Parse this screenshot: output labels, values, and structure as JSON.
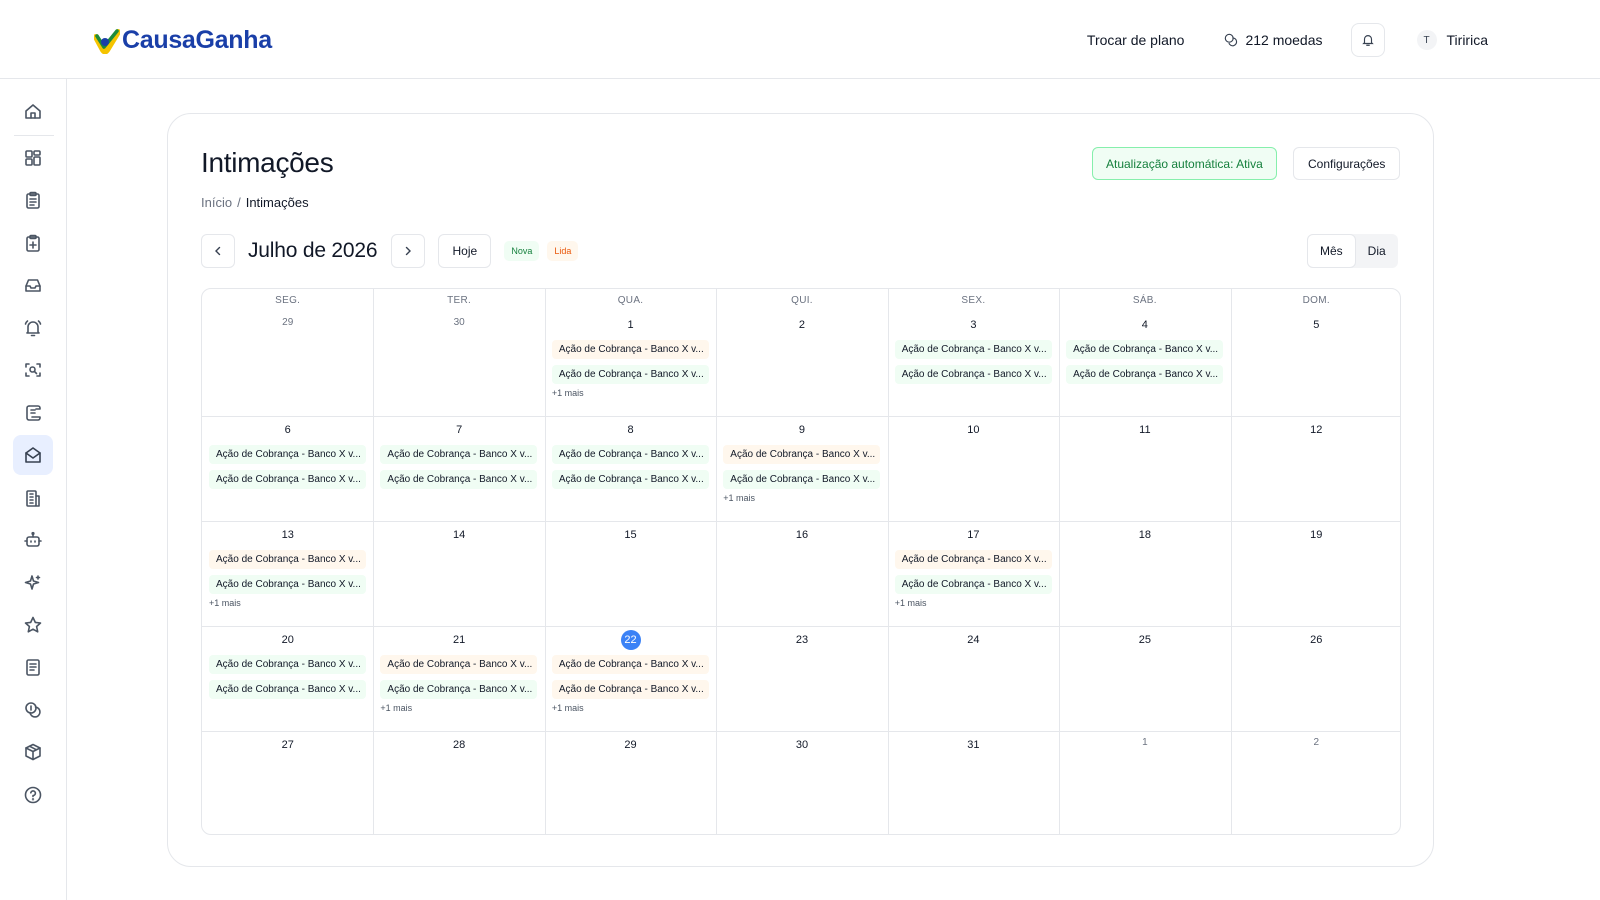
{
  "app": {
    "name": "CausaGanha"
  },
  "header": {
    "change_plan": "Trocar de plano",
    "coins": "212 moedas",
    "user_initial": "T",
    "user_name": "Tiririca"
  },
  "sidebar": {
    "items": [
      {
        "icon": "home-icon"
      },
      {
        "icon": "dashboard-icon"
      },
      {
        "icon": "clipboard-list-icon"
      },
      {
        "icon": "clipboard-plus-icon"
      },
      {
        "icon": "inbox-icon"
      },
      {
        "icon": "bell-ring-icon"
      },
      {
        "icon": "scan-search-icon"
      },
      {
        "icon": "scroll-icon"
      },
      {
        "icon": "mail-open-icon",
        "active": true
      },
      {
        "icon": "building-icon"
      },
      {
        "icon": "bot-icon"
      },
      {
        "icon": "sparkles-icon"
      },
      {
        "icon": "star-icon"
      },
      {
        "icon": "notebook-icon"
      },
      {
        "icon": "coins-icon"
      },
      {
        "icon": "package-icon"
      },
      {
        "icon": "help-circle-icon"
      }
    ]
  },
  "page": {
    "title": "Intimações",
    "breadcrumb": {
      "home": "Início",
      "sep": "/",
      "current": "Intimações"
    },
    "auto_update": "Atualização automática: Ativa",
    "settings_button": "Configurações"
  },
  "calendar": {
    "month_label": "Julho de 2026",
    "today_button": "Hoje",
    "legend": {
      "nova": "Nova",
      "lida": "Lida"
    },
    "views": {
      "month": "Mês",
      "day": "Dia",
      "active": "month"
    },
    "weekdays": [
      "SEG.",
      "TER.",
      "QUA.",
      "QUI.",
      "SEX.",
      "SÁB.",
      "DOM."
    ],
    "colors": {
      "nova_bg": "#f0fdf4",
      "lida_bg": "#fff7ed",
      "today": "#3b82f6",
      "nova_text": "#15803d",
      "lida_text": "#ea580c"
    },
    "weeks": [
      [
        {
          "day": "29",
          "muted": true,
          "events": []
        },
        {
          "day": "30",
          "muted": true,
          "events": []
        },
        {
          "day": "1",
          "events": [
            {
              "t": "Ação de Cobrança - Banco X v...",
              "s": "lida"
            },
            {
              "t": "Ação de Cobrança - Banco X v...",
              "s": "nova"
            }
          ],
          "more": "+1 mais"
        },
        {
          "day": "2",
          "events": []
        },
        {
          "day": "3",
          "events": [
            {
              "t": "Ação de Cobrança - Banco X v...",
              "s": "nova"
            },
            {
              "t": "Ação de Cobrança - Banco X v...",
              "s": "nova"
            }
          ]
        },
        {
          "day": "4",
          "events": [
            {
              "t": "Ação de Cobrança - Banco X v...",
              "s": "nova"
            },
            {
              "t": "Ação de Cobrança - Banco X v...",
              "s": "nova"
            }
          ]
        },
        {
          "day": "5",
          "events": []
        }
      ],
      [
        {
          "day": "6",
          "events": [
            {
              "t": "Ação de Cobrança - Banco X v...",
              "s": "nova"
            },
            {
              "t": "Ação de Cobrança - Banco X v...",
              "s": "nova"
            }
          ]
        },
        {
          "day": "7",
          "events": [
            {
              "t": "Ação de Cobrança - Banco X v...",
              "s": "nova"
            },
            {
              "t": "Ação de Cobrança - Banco X v...",
              "s": "nova"
            }
          ]
        },
        {
          "day": "8",
          "events": [
            {
              "t": "Ação de Cobrança - Banco X v...",
              "s": "nova"
            },
            {
              "t": "Ação de Cobrança - Banco X v...",
              "s": "nova"
            }
          ]
        },
        {
          "day": "9",
          "events": [
            {
              "t": "Ação de Cobrança - Banco X v...",
              "s": "lida"
            },
            {
              "t": "Ação de Cobrança - Banco X v...",
              "s": "nova"
            }
          ],
          "more": "+1 mais"
        },
        {
          "day": "10",
          "events": []
        },
        {
          "day": "11",
          "events": []
        },
        {
          "day": "12",
          "events": []
        }
      ],
      [
        {
          "day": "13",
          "events": [
            {
              "t": "Ação de Cobrança - Banco X v...",
              "s": "lida"
            },
            {
              "t": "Ação de Cobrança - Banco X v...",
              "s": "nova"
            }
          ],
          "more": "+1 mais"
        },
        {
          "day": "14",
          "events": []
        },
        {
          "day": "15",
          "events": []
        },
        {
          "day": "16",
          "events": []
        },
        {
          "day": "17",
          "events": [
            {
              "t": "Ação de Cobrança - Banco X v...",
              "s": "lida"
            },
            {
              "t": "Ação de Cobrança - Banco X v...",
              "s": "nova"
            }
          ],
          "more": "+1 mais"
        },
        {
          "day": "18",
          "events": []
        },
        {
          "day": "19",
          "events": []
        }
      ],
      [
        {
          "day": "20",
          "events": [
            {
              "t": "Ação de Cobrança - Banco X v...",
              "s": "nova"
            },
            {
              "t": "Ação de Cobrança - Banco X v...",
              "s": "nova"
            }
          ]
        },
        {
          "day": "21",
          "events": [
            {
              "t": "Ação de Cobrança - Banco X v...",
              "s": "lida"
            },
            {
              "t": "Ação de Cobrança - Banco X v...",
              "s": "nova"
            }
          ],
          "more": "+1 mais"
        },
        {
          "day": "22",
          "today": true,
          "events": [
            {
              "t": "Ação de Cobrança - Banco X v...",
              "s": "lida"
            },
            {
              "t": "Ação de Cobrança - Banco X v...",
              "s": "lida"
            }
          ],
          "more": "+1 mais"
        },
        {
          "day": "23",
          "events": []
        },
        {
          "day": "24",
          "events": []
        },
        {
          "day": "25",
          "events": []
        },
        {
          "day": "26",
          "events": []
        }
      ],
      [
        {
          "day": "27",
          "events": []
        },
        {
          "day": "28",
          "events": []
        },
        {
          "day": "29",
          "events": []
        },
        {
          "day": "30",
          "events": []
        },
        {
          "day": "31",
          "events": []
        },
        {
          "day": "1",
          "muted": true,
          "events": []
        },
        {
          "day": "2",
          "muted": true,
          "events": []
        }
      ]
    ]
  }
}
